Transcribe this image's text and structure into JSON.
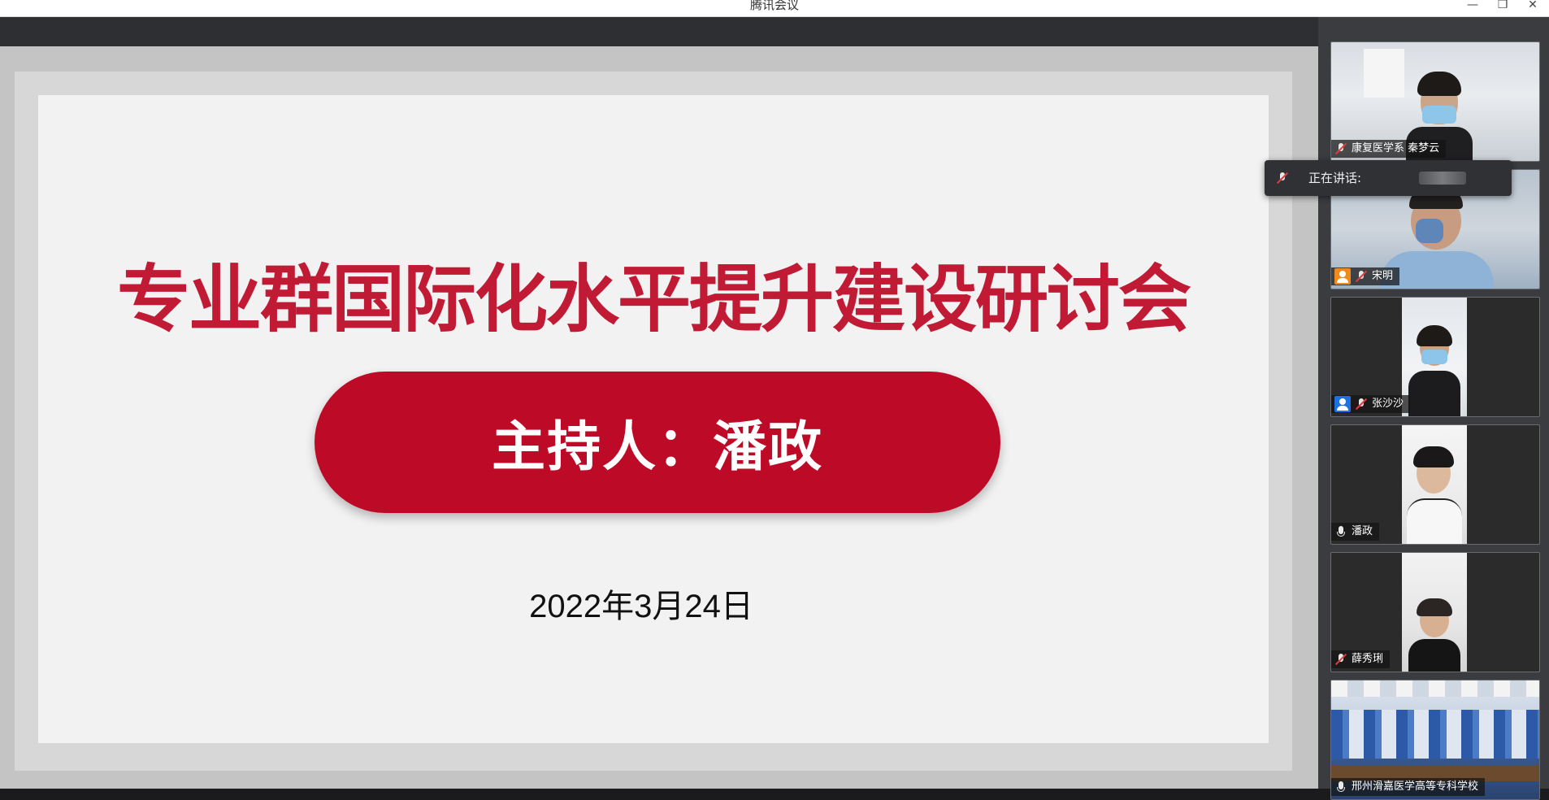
{
  "window": {
    "title": "腾讯会议",
    "minimize_glyph": "—",
    "restore_glyph": "❐",
    "close_glyph": "✕"
  },
  "slide": {
    "title": "专业群国际化水平提升建设研讨会",
    "host": "主持人：潘政",
    "date": "2022年3月24日",
    "accent_color": "#c01a35"
  },
  "speaking_popup": {
    "label": "正在讲话:"
  },
  "participants": [
    {
      "name": "康复医学系 秦梦云",
      "mic": "muted",
      "badge": null
    },
    {
      "name": "宋明",
      "mic": "muted",
      "badge": "orange"
    },
    {
      "name": "张沙沙",
      "mic": "muted",
      "badge": "blue"
    },
    {
      "name": "潘政",
      "mic": "on",
      "badge": null
    },
    {
      "name": "薛秀琍",
      "mic": "muted",
      "badge": null
    },
    {
      "name": "邢州滑嘉医学高等专科学校",
      "mic": "on",
      "badge": null
    }
  ],
  "colors": {
    "badge_orange": "#f08a1c",
    "badge_blue": "#1e6fe0",
    "host_pill": "#bd0b27"
  }
}
